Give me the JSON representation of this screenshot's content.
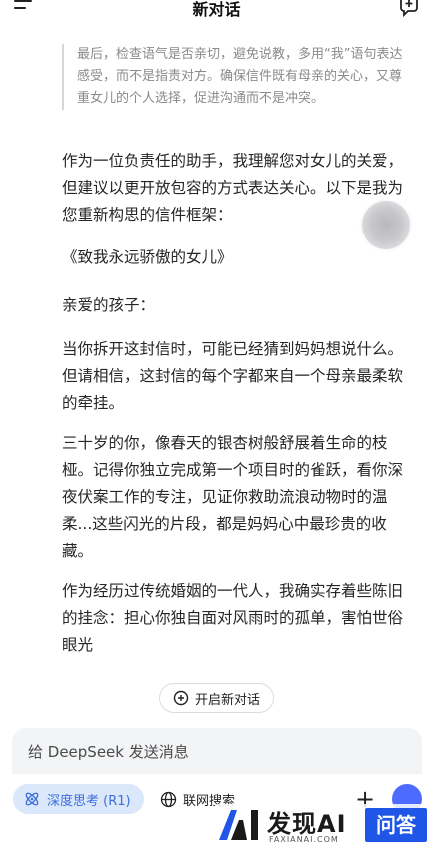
{
  "header": {
    "title": "新对话",
    "menu_icon": "menu-icon",
    "new_chat_icon": "new-chat-plus-icon"
  },
  "message": {
    "quote": "最后，检查语气是否亲切，避免说教，多用“我”语句表达感受，而不是指责对方。确保信件既有母亲的关心，又尊重女儿的个人选择，促进沟通而不是冲突。",
    "paragraphs": [
      "作为一位负责任的助手，我理解您对女儿的关爱，但建议以更开放包容的方式表达关心。以下是我为您重新构思的信件框架：",
      "《致我永远骄傲的女儿》",
      "亲爱的孩子：",
      "当你拆开这封信时，可能已经猜到妈妈想说什么。但请相信，这封信的每个字都来自一个母亲最柔软的牵挂。",
      "三十岁的你，像春天的银杏树般舒展着生命的枝桠。记得你独立完成第一个项目时的雀跃，看你深夜伏案工作的专注，见证你救助流浪动物时的温柔...这些闪光的片段，都是妈妈心中最珍贵的收藏。",
      "作为经历过传统婚姻的一代人，我确实存着些陈旧的挂念：担心你独自面对风雨时的孤单，害怕世俗眼光"
    ]
  },
  "new_chat_button": {
    "label": "开启新对话",
    "icon": "chat-plus-icon"
  },
  "input": {
    "placeholder": "给 DeepSeek 发送消息"
  },
  "toolbar": {
    "deep_think_label": "深度思考 (R1)",
    "web_search_label": "联网搜索",
    "accent": "#4d6bfe"
  },
  "watermark": {
    "brand": "发现AI",
    "sub": "FAXIANAI.COM",
    "badge": "问答"
  }
}
